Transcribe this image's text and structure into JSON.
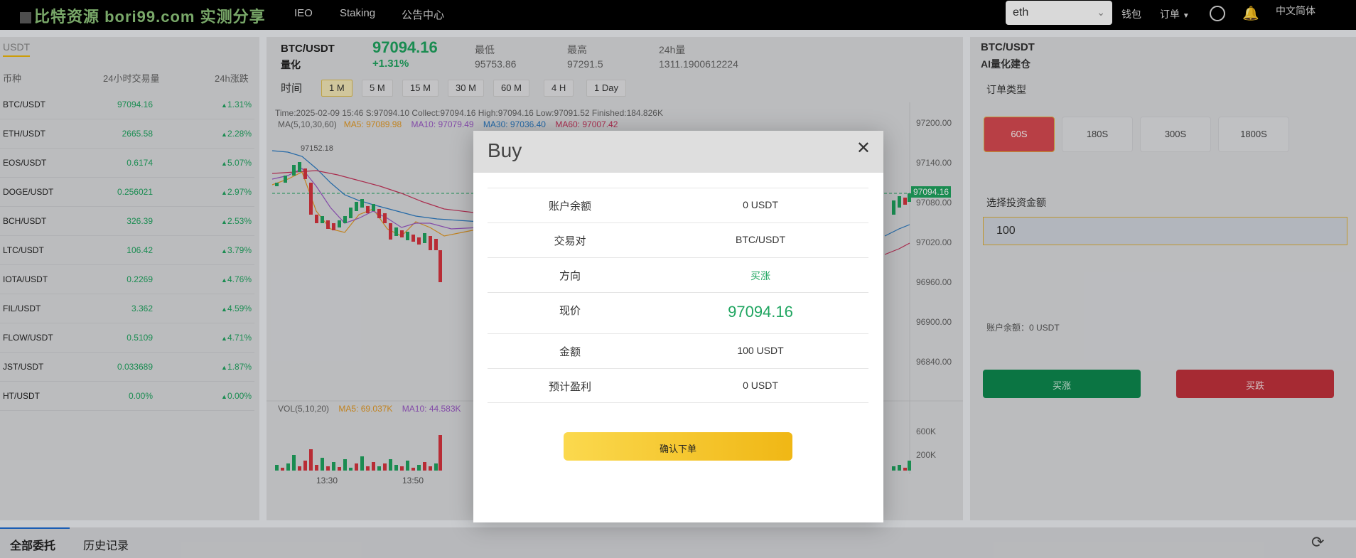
{
  "topbar": {
    "logo": "比特资源 bori99.com 实测分享",
    "nav": [
      "IEO",
      "Staking",
      "公告中心"
    ],
    "search_value": "eth",
    "wallet": "钱包",
    "orders": "订单",
    "language": "中文简体"
  },
  "markets": {
    "tab": "USDT",
    "headers": [
      "币种",
      "24小时交易量",
      "24h涨跌"
    ],
    "rows": [
      {
        "symbol": "BTC/USDT",
        "price": "97094.16",
        "change": "1.31%"
      },
      {
        "symbol": "ETH/USDT",
        "price": "2665.58",
        "change": "2.28%"
      },
      {
        "symbol": "EOS/USDT",
        "price": "0.6174",
        "change": "5.07%"
      },
      {
        "symbol": "DOGE/USDT",
        "price": "0.256021",
        "change": "2.97%"
      },
      {
        "symbol": "BCH/USDT",
        "price": "326.39",
        "change": "2.53%"
      },
      {
        "symbol": "LTC/USDT",
        "price": "106.42",
        "change": "3.79%"
      },
      {
        "symbol": "IOTA/USDT",
        "price": "0.2269",
        "change": "4.76%"
      },
      {
        "symbol": "FIL/USDT",
        "price": "3.362",
        "change": "4.59%"
      },
      {
        "symbol": "FLOW/USDT",
        "price": "0.5109",
        "change": "4.71%"
      },
      {
        "symbol": "JST/USDT",
        "price": "0.033689",
        "change": "1.87%"
      },
      {
        "symbol": "HT/USDT",
        "price": "0.00%",
        "change": "0.00%"
      }
    ]
  },
  "ticker": {
    "pair": "BTC/USDT",
    "sub": "量化",
    "price": "97094.16",
    "change": "+1.31%",
    "low_label": "最低",
    "low": "95753.86",
    "high_label": "最高",
    "high": "97291.5",
    "vol_label": "24h量",
    "vol": "1311.1900612224"
  },
  "chart": {
    "time_label": "时间",
    "timeframes": [
      "1 M",
      "5 M",
      "15 M",
      "30 M",
      "60 M",
      "4 H",
      "1 Day"
    ],
    "info": "Time:2025-02-09 15:46   S:97094.10    Collect:97094.16    High:97094.16    Low:97091.52   Finished:184.826K",
    "ma_label": "MA(5,10,30,60)",
    "ma5": "MA5: 97089.98",
    "ma10": "MA10: 97079.49",
    "ma30": "MA30: 97036.40",
    "ma60": "MA60: 97007.42",
    "peak_label": "97152.18",
    "price_axis": [
      "97200.00",
      "97140.00",
      "97080.00",
      "97020.00",
      "96960.00",
      "96900.00",
      "96840.00"
    ],
    "last_price_tag": "97094.16",
    "vol_label": "VOL(5,10,20)",
    "vol_ma5": "MA5: 69.037K",
    "vol_ma10": "MA10: 44.583K",
    "vol_axis": [
      "600K",
      "200K"
    ],
    "time_axis": [
      "13:30",
      "13:50"
    ]
  },
  "order_panel": {
    "pair": "BTC/USDT",
    "sub": "AI量化建仓",
    "type_label": "订单类型",
    "periods": [
      "60S",
      "180S",
      "300S",
      "1800S"
    ],
    "amount_label": "选择投资金额",
    "amount_value": "100",
    "balance": "账户余额：0 USDT",
    "buy_up": "买涨",
    "buy_down": "买跌"
  },
  "bottom": {
    "tabs": [
      "全部委托",
      "历史记录"
    ]
  },
  "modal": {
    "title": "Buy",
    "rows": [
      {
        "key": "账户余额",
        "value": "0 USDT"
      },
      {
        "key": "交易对",
        "value": "BTC/USDT"
      },
      {
        "key": "方向",
        "value": "买涨"
      },
      {
        "key": "现价",
        "value": "97094.16"
      },
      {
        "key": "金额",
        "value": "100 USDT"
      },
      {
        "key": "预计盈利",
        "value": "0 USDT"
      }
    ],
    "confirm": "确认下单"
  },
  "colors": {
    "up": "#1fa560",
    "down": "#c4323d",
    "accent": "#f0b90b"
  }
}
